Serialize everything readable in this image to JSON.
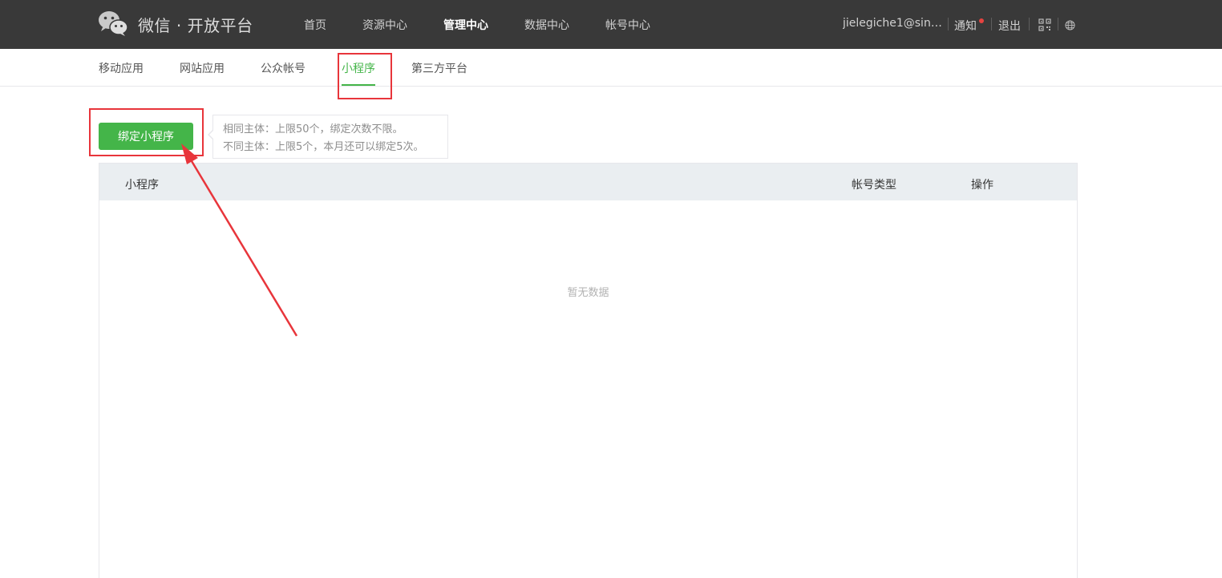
{
  "header": {
    "brand": "微信 · 开放平台",
    "nav": [
      {
        "label": "首页",
        "active": false
      },
      {
        "label": "资源中心",
        "active": false
      },
      {
        "label": "管理中心",
        "active": true
      },
      {
        "label": "数据中心",
        "active": false
      },
      {
        "label": "帐号中心",
        "active": false
      }
    ],
    "user_email": "jielegiche1@sina...",
    "notice_label": "通知",
    "logout_label": "退出",
    "icons": [
      "wechat-logo-icon",
      "qr-code-icon",
      "globe-icon"
    ]
  },
  "subnav": {
    "items": [
      {
        "label": "移动应用",
        "active": false
      },
      {
        "label": "网站应用",
        "active": false
      },
      {
        "label": "公众帐号",
        "active": false
      },
      {
        "label": "小程序",
        "active": true
      },
      {
        "label": "第三方平台",
        "active": false
      }
    ]
  },
  "main": {
    "bind_button_label": "绑定小程序",
    "tip": {
      "line1": "相同主体：上限50个，绑定次数不限。",
      "line2": "不同主体：上限5个，本月还可以绑定5次。"
    },
    "table": {
      "columns": [
        "小程序",
        "帐号类型",
        "操作"
      ],
      "rows": [],
      "empty_text": "暂无数据"
    }
  },
  "colors": {
    "header_bg": "#393939",
    "accent_green": "#44b549",
    "annotation_red": "#e8353b",
    "table_header_bg": "#eaeef1"
  }
}
